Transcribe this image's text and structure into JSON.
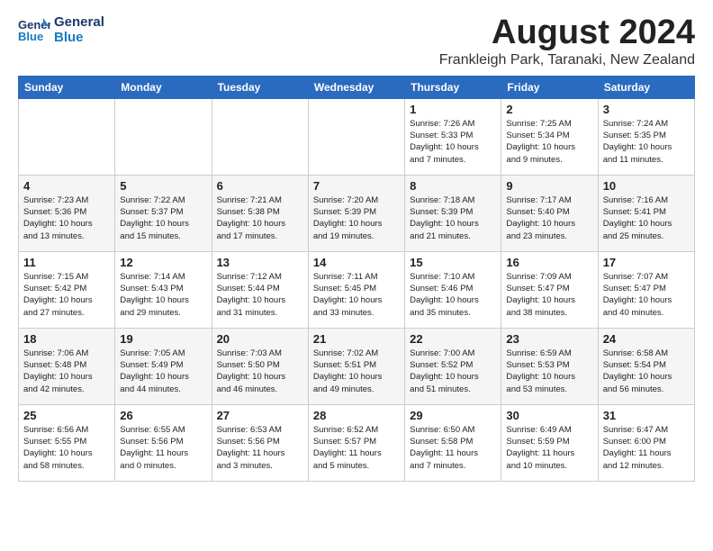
{
  "logo": {
    "line1": "General",
    "line2": "Blue"
  },
  "title": "August 2024",
  "subtitle": "Frankleigh Park, Taranaki, New Zealand",
  "weekdays": [
    "Sunday",
    "Monday",
    "Tuesday",
    "Wednesday",
    "Thursday",
    "Friday",
    "Saturday"
  ],
  "weeks": [
    [
      {
        "day": "",
        "info": ""
      },
      {
        "day": "",
        "info": ""
      },
      {
        "day": "",
        "info": ""
      },
      {
        "day": "",
        "info": ""
      },
      {
        "day": "1",
        "info": "Sunrise: 7:26 AM\nSunset: 5:33 PM\nDaylight: 10 hours\nand 7 minutes."
      },
      {
        "day": "2",
        "info": "Sunrise: 7:25 AM\nSunset: 5:34 PM\nDaylight: 10 hours\nand 9 minutes."
      },
      {
        "day": "3",
        "info": "Sunrise: 7:24 AM\nSunset: 5:35 PM\nDaylight: 10 hours\nand 11 minutes."
      }
    ],
    [
      {
        "day": "4",
        "info": "Sunrise: 7:23 AM\nSunset: 5:36 PM\nDaylight: 10 hours\nand 13 minutes."
      },
      {
        "day": "5",
        "info": "Sunrise: 7:22 AM\nSunset: 5:37 PM\nDaylight: 10 hours\nand 15 minutes."
      },
      {
        "day": "6",
        "info": "Sunrise: 7:21 AM\nSunset: 5:38 PM\nDaylight: 10 hours\nand 17 minutes."
      },
      {
        "day": "7",
        "info": "Sunrise: 7:20 AM\nSunset: 5:39 PM\nDaylight: 10 hours\nand 19 minutes."
      },
      {
        "day": "8",
        "info": "Sunrise: 7:18 AM\nSunset: 5:39 PM\nDaylight: 10 hours\nand 21 minutes."
      },
      {
        "day": "9",
        "info": "Sunrise: 7:17 AM\nSunset: 5:40 PM\nDaylight: 10 hours\nand 23 minutes."
      },
      {
        "day": "10",
        "info": "Sunrise: 7:16 AM\nSunset: 5:41 PM\nDaylight: 10 hours\nand 25 minutes."
      }
    ],
    [
      {
        "day": "11",
        "info": "Sunrise: 7:15 AM\nSunset: 5:42 PM\nDaylight: 10 hours\nand 27 minutes."
      },
      {
        "day": "12",
        "info": "Sunrise: 7:14 AM\nSunset: 5:43 PM\nDaylight: 10 hours\nand 29 minutes."
      },
      {
        "day": "13",
        "info": "Sunrise: 7:12 AM\nSunset: 5:44 PM\nDaylight: 10 hours\nand 31 minutes."
      },
      {
        "day": "14",
        "info": "Sunrise: 7:11 AM\nSunset: 5:45 PM\nDaylight: 10 hours\nand 33 minutes."
      },
      {
        "day": "15",
        "info": "Sunrise: 7:10 AM\nSunset: 5:46 PM\nDaylight: 10 hours\nand 35 minutes."
      },
      {
        "day": "16",
        "info": "Sunrise: 7:09 AM\nSunset: 5:47 PM\nDaylight: 10 hours\nand 38 minutes."
      },
      {
        "day": "17",
        "info": "Sunrise: 7:07 AM\nSunset: 5:47 PM\nDaylight: 10 hours\nand 40 minutes."
      }
    ],
    [
      {
        "day": "18",
        "info": "Sunrise: 7:06 AM\nSunset: 5:48 PM\nDaylight: 10 hours\nand 42 minutes."
      },
      {
        "day": "19",
        "info": "Sunrise: 7:05 AM\nSunset: 5:49 PM\nDaylight: 10 hours\nand 44 minutes."
      },
      {
        "day": "20",
        "info": "Sunrise: 7:03 AM\nSunset: 5:50 PM\nDaylight: 10 hours\nand 46 minutes."
      },
      {
        "day": "21",
        "info": "Sunrise: 7:02 AM\nSunset: 5:51 PM\nDaylight: 10 hours\nand 49 minutes."
      },
      {
        "day": "22",
        "info": "Sunrise: 7:00 AM\nSunset: 5:52 PM\nDaylight: 10 hours\nand 51 minutes."
      },
      {
        "day": "23",
        "info": "Sunrise: 6:59 AM\nSunset: 5:53 PM\nDaylight: 10 hours\nand 53 minutes."
      },
      {
        "day": "24",
        "info": "Sunrise: 6:58 AM\nSunset: 5:54 PM\nDaylight: 10 hours\nand 56 minutes."
      }
    ],
    [
      {
        "day": "25",
        "info": "Sunrise: 6:56 AM\nSunset: 5:55 PM\nDaylight: 10 hours\nand 58 minutes."
      },
      {
        "day": "26",
        "info": "Sunrise: 6:55 AM\nSunset: 5:56 PM\nDaylight: 11 hours\nand 0 minutes."
      },
      {
        "day": "27",
        "info": "Sunrise: 6:53 AM\nSunset: 5:56 PM\nDaylight: 11 hours\nand 3 minutes."
      },
      {
        "day": "28",
        "info": "Sunrise: 6:52 AM\nSunset: 5:57 PM\nDaylight: 11 hours\nand 5 minutes."
      },
      {
        "day": "29",
        "info": "Sunrise: 6:50 AM\nSunset: 5:58 PM\nDaylight: 11 hours\nand 7 minutes."
      },
      {
        "day": "30",
        "info": "Sunrise: 6:49 AM\nSunset: 5:59 PM\nDaylight: 11 hours\nand 10 minutes."
      },
      {
        "day": "31",
        "info": "Sunrise: 6:47 AM\nSunset: 6:00 PM\nDaylight: 11 hours\nand 12 minutes."
      }
    ]
  ]
}
